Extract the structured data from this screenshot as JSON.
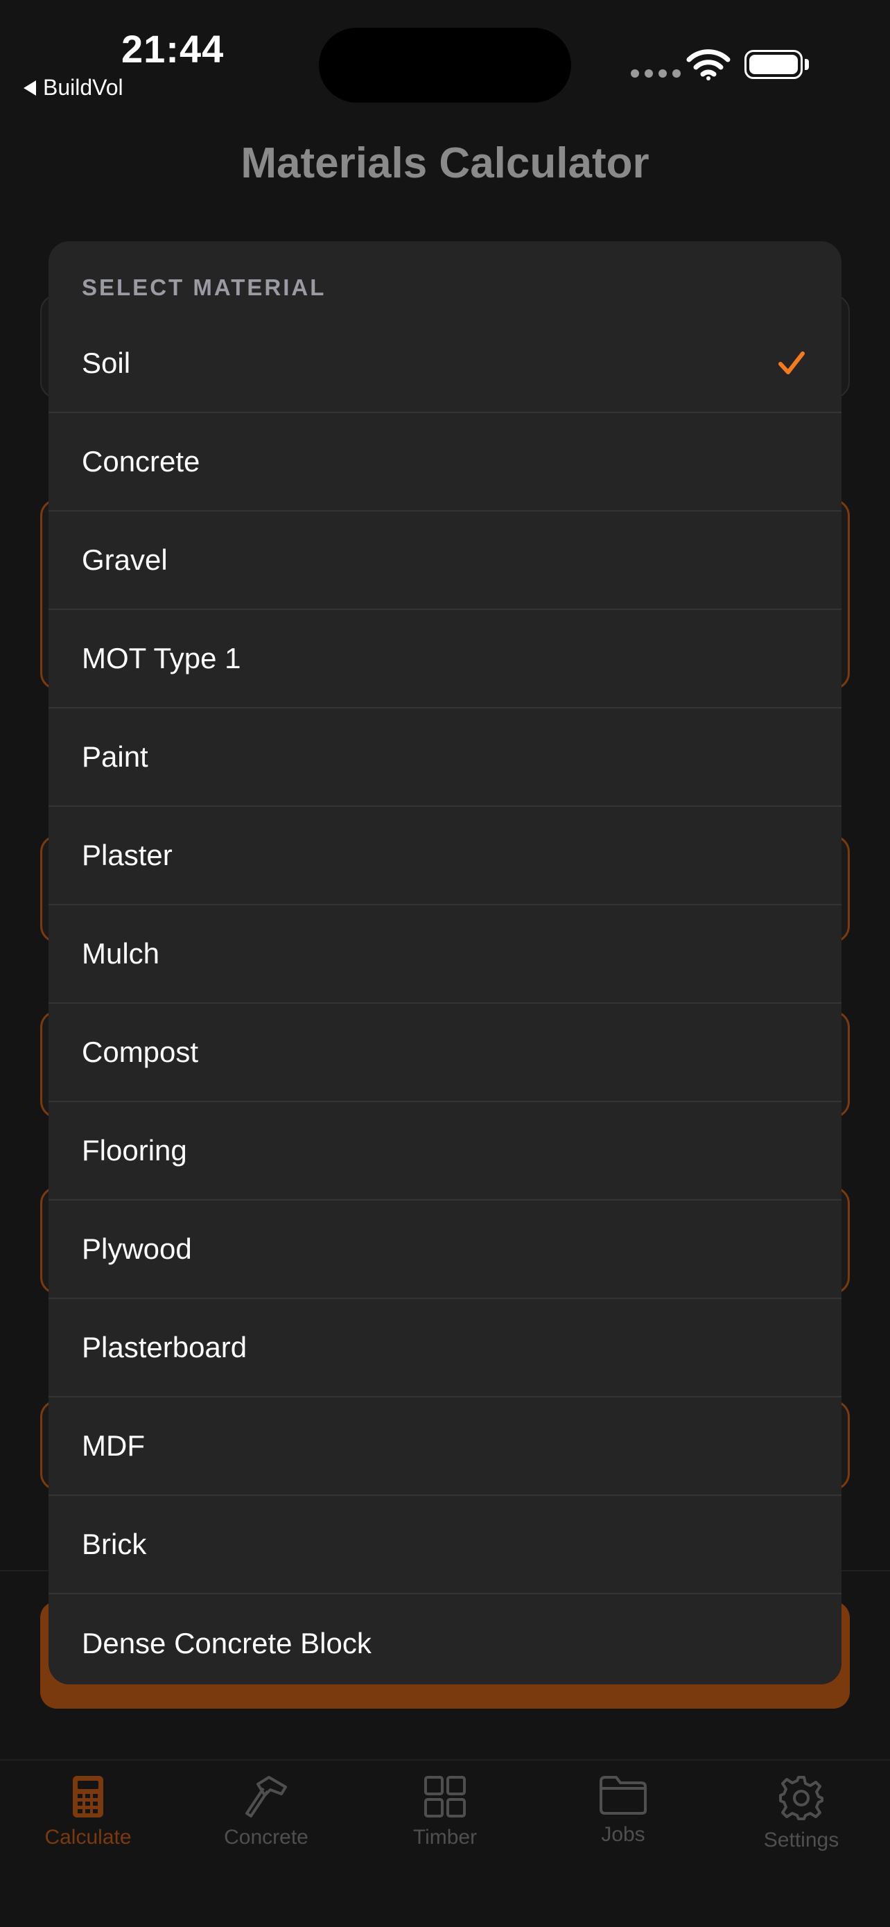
{
  "status_bar": {
    "time": "21:44",
    "back_app": "BuildVol"
  },
  "page": {
    "title": "Materials Calculator"
  },
  "dropdown": {
    "header": "SELECT MATERIAL",
    "selected": "Soil",
    "items": [
      {
        "label": "Soil",
        "selected": true
      },
      {
        "label": "Concrete"
      },
      {
        "label": "Gravel"
      },
      {
        "label": "MOT Type 1"
      },
      {
        "label": "Paint"
      },
      {
        "label": "Plaster"
      },
      {
        "label": "Mulch"
      },
      {
        "label": "Compost"
      },
      {
        "label": "Flooring"
      },
      {
        "label": "Plywood"
      },
      {
        "label": "Plasterboard"
      },
      {
        "label": "MDF"
      },
      {
        "label": "Brick"
      },
      {
        "label": "Dense Concrete Block"
      }
    ]
  },
  "tab_bar": {
    "tabs": [
      {
        "label": "Calculate",
        "icon": "calculator-icon",
        "active": true
      },
      {
        "label": "Concrete",
        "icon": "hammer-icon"
      },
      {
        "label": "Timber",
        "icon": "grid-icon"
      },
      {
        "label": "Jobs",
        "icon": "folder-icon"
      },
      {
        "label": "Settings",
        "icon": "gear-icon"
      }
    ]
  },
  "colors": {
    "accent": "#F47A20",
    "accent_dimmed": "#7A3A0D",
    "background": "#141414",
    "sheet": "#252525"
  }
}
